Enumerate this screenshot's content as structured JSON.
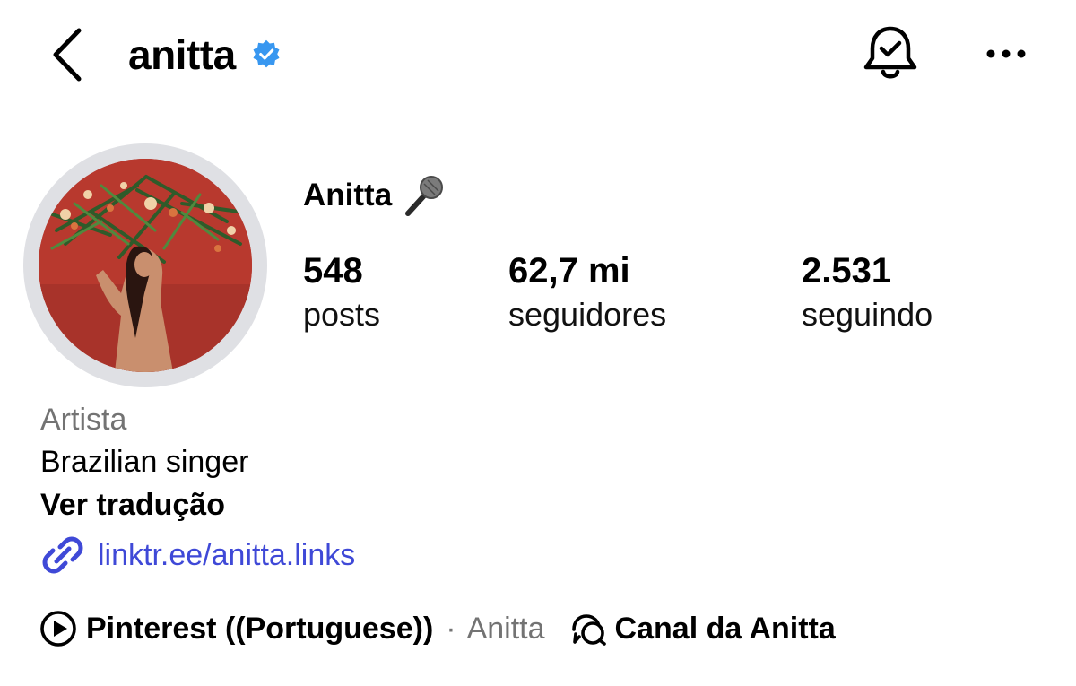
{
  "header": {
    "username": "anitta",
    "verified_color": "#3897f0"
  },
  "profile": {
    "display_name": "Anitta",
    "name_emoji_icon": "microphone-icon",
    "stats": [
      {
        "value": "548",
        "label": "posts"
      },
      {
        "value": "62,7 mi",
        "label": "seguidores"
      },
      {
        "value": "2.531",
        "label": "seguindo"
      }
    ]
  },
  "bio": {
    "category": "Artista",
    "text": "Brazilian singer",
    "translate_label": "Ver tradução",
    "link": "linktr.ee/anitta.links",
    "link_color": "#3f49d7"
  },
  "meta": {
    "pinterest_label": "Pinterest ((Portuguese))",
    "separator": "·",
    "artist_name": "Anitta",
    "channel_label": "Canal da Anitta"
  },
  "colors": {
    "avatar_ring": "#dfe0e4",
    "avatar_bg": "#b7392f",
    "muted_text": "#737373"
  }
}
